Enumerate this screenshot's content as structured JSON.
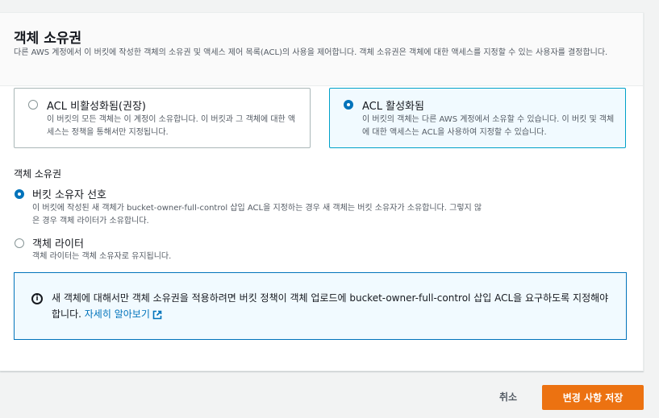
{
  "panel": {
    "title": "객체 소유권",
    "description": "다른 AWS 계정에서 이 버킷에 작성한 객체의 소유권 및 액세스 제어 목록(ACL)의 사용을 제어합니다. 객체 소유권은 객체에 대한 액세스를 지정할 수 있는 사용자를 결정합니다."
  },
  "acl_tiles": [
    {
      "label": "ACL 비활성화됨(권장)",
      "desc": "이 버킷의 모든 객체는 이 계정이 소유합니다. 이 버킷과 그 객체에 대한 액세스는 정책을 통해서만 지정됩니다.",
      "selected": false
    },
    {
      "label": "ACL 활성화됨",
      "desc": "이 버킷의 객체는 다른 AWS 계정에서 소유할 수 있습니다. 이 버킷 및 객체에 대한 액세스는 ACL을 사용하여 지정할 수 있습니다.",
      "selected": true
    }
  ],
  "ownership": {
    "label": "객체 소유권",
    "options": [
      {
        "label": "버킷 소유자 선호",
        "desc": "이 버킷에 작성된 새 객체가 bucket-owner-full-control 삽입 ACL을 지정하는 경우 새 객체는 버킷 소유자가 소유합니다. 그렇지 않은 경우 객체 라이터가 소유합니다.",
        "selected": true
      },
      {
        "label": "객체 라이터",
        "desc": "객체 라이터는 객체 소유자로 유지됩니다.",
        "selected": false
      }
    ]
  },
  "info": {
    "icon": "info-icon",
    "text": "새 객체에 대해서만 객체 소유권을 적용하려면 버킷 정책이 객체 업로드에 bucket-owner-full-control 삽입 ACL을 요구하도록 지정해야 합니다.",
    "link": "자세히 알아보기"
  },
  "footer": {
    "cancel_label": "취소",
    "save_label": "변경 사항 저장"
  },
  "colors": {
    "accent": "#0073bb",
    "primary_button": "#ec7211",
    "selected_border": "#00a1c9"
  }
}
